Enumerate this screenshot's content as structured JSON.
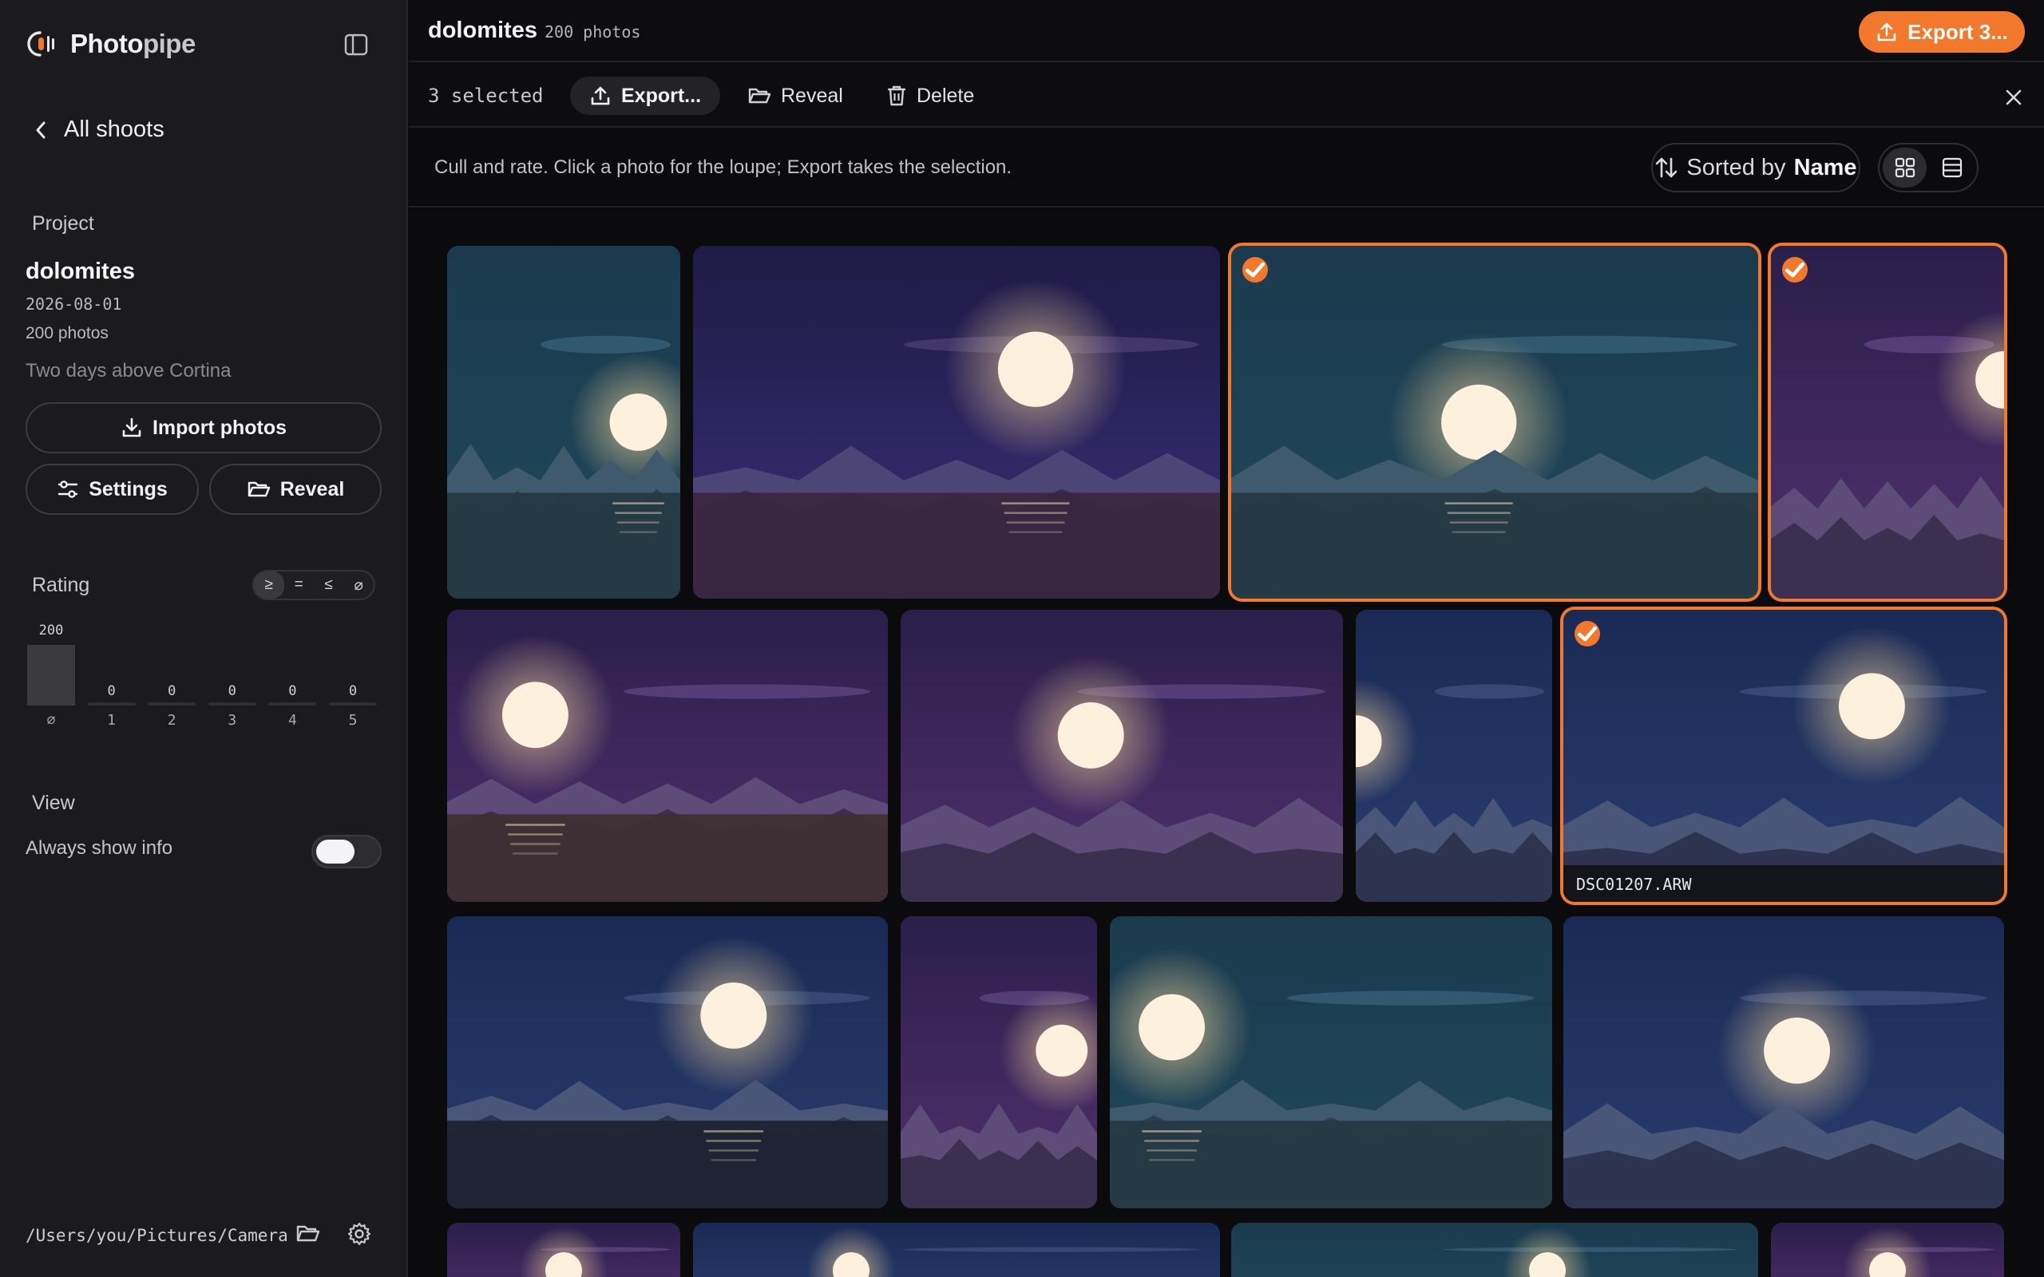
{
  "app": {
    "name_part1": "Photo",
    "name_part2": "pipe"
  },
  "sidebar": {
    "back_label": "All shoots",
    "project_label": "Project",
    "project": {
      "name": "dolomites",
      "date": "2026-08-01",
      "photo_count": "200 photos",
      "description": "Two days above Cortina"
    },
    "import_label": "Import photos",
    "settings_label": "Settings",
    "reveal_label": "Reveal",
    "rating_label": "Rating",
    "rating_filters": [
      "≥",
      "=",
      "≤",
      "⌀"
    ],
    "histogram": [
      {
        "label": "⌀",
        "count": "200",
        "value": 200
      },
      {
        "label": "1",
        "count": "0",
        "value": 0
      },
      {
        "label": "2",
        "count": "0",
        "value": 0
      },
      {
        "label": "3",
        "count": "0",
        "value": 0
      },
      {
        "label": "4",
        "count": "0",
        "value": 0
      },
      {
        "label": "5",
        "count": "0",
        "value": 0
      }
    ],
    "view_label": "View",
    "always_show_info_label": "Always show info",
    "always_show_info": false,
    "footer_path": "/Users/you/Pictures/Camera"
  },
  "topbar": {
    "title": "dolomites",
    "count": "200 photos",
    "export_cta": "Export 3..."
  },
  "selection_bar": {
    "count_label": "3 selected",
    "export_label": "Export...",
    "reveal_label": "Reveal",
    "delete_label": "Delete"
  },
  "info_bar": {
    "hint": "Cull and rate. Click a photo for the loupe; Export takes the selection.",
    "sort_prefix": "Sorted by",
    "sort_key": "Name",
    "view_mode": "grid"
  },
  "colors": {
    "accent": "#f2792b",
    "sidebar_bg": "#1b1b1e",
    "main_bg": "#0b0b0d"
  },
  "photos": [
    {
      "theme": "teal",
      "selected": false,
      "caption": ""
    },
    {
      "theme": "violet",
      "selected": false,
      "caption": ""
    },
    {
      "theme": "teal",
      "selected": true,
      "caption": ""
    },
    {
      "theme": "purple",
      "selected": true,
      "caption": ""
    },
    {
      "theme": "purple",
      "selected": false,
      "caption": ""
    },
    {
      "theme": "purple",
      "selected": false,
      "caption": ""
    },
    {
      "theme": "navy",
      "selected": false,
      "caption": ""
    },
    {
      "theme": "navy",
      "selected": true,
      "caption": "DSC01207.ARW"
    },
    {
      "theme": "navy",
      "selected": false,
      "caption": ""
    },
    {
      "theme": "purple",
      "selected": false,
      "caption": ""
    },
    {
      "theme": "teal",
      "selected": false,
      "caption": ""
    },
    {
      "theme": "navy",
      "selected": false,
      "caption": ""
    },
    {
      "theme": "purple",
      "selected": false,
      "caption": ""
    },
    {
      "theme": "navy",
      "selected": false,
      "caption": ""
    },
    {
      "theme": "teal",
      "selected": false,
      "caption": ""
    },
    {
      "theme": "purple",
      "selected": false,
      "caption": ""
    }
  ]
}
